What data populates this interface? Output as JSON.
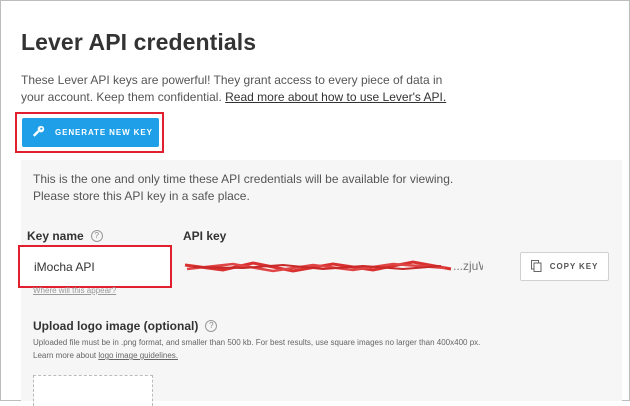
{
  "header": {
    "title": "Lever API credentials",
    "intro_text": "These Lever API keys are powerful! They grant access to every piece of data in your account. Keep them confidential. ",
    "intro_link": "Read more about how to use Lever's API."
  },
  "actions": {
    "generate_label": "GENERATE NEW KEY",
    "generate_icon": "key-icon",
    "accent_color": "#1e9fe8",
    "highlight_color": "#e0202e"
  },
  "credentials": {
    "notice_line1": "This is the one and only time these API credentials will be available for viewing.",
    "notice_line2": "Please store this API key in a safe place.",
    "key_name_label": "Key name",
    "key_name_help": "?",
    "key_name_value": "iMocha API",
    "where_link": "Where will this appear?",
    "api_key_label": "API key",
    "api_key_value": "...zjuW",
    "copy_label": "COPY KEY",
    "copy_icon": "copy-icon"
  },
  "logo": {
    "label": "Upload logo image (optional)",
    "help": "?",
    "hint_line1": "Uploaded file must be in .png format, and smaller than 500 kb. For best results, use square images no larger than 400x400 px.",
    "hint_line2_prefix": "Learn more about ",
    "hint_link": "logo image guidelines."
  }
}
